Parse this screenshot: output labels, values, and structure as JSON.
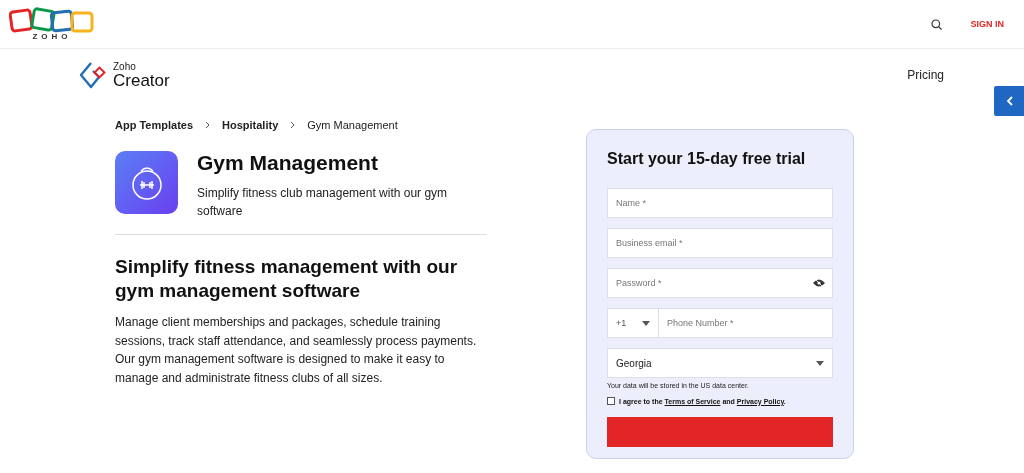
{
  "header": {
    "brand": "ZOHO",
    "sign_in": "SIGN IN"
  },
  "nav": {
    "product_small": "Zoho",
    "product": "Creator",
    "links": [
      "Pricing"
    ]
  },
  "breadcrumb": [
    "App Templates",
    "Hospitality",
    "Gym Management"
  ],
  "app": {
    "title": "Gym Management",
    "subtitle": "Simplify fitness club management with our gym software"
  },
  "section": {
    "heading": "Simplify fitness management with our gym management software",
    "body": "Manage client memberships and packages, schedule training sessions, track staff attendance, and seamlessly process payments. Our gym management software is designed to make it easy to manage and administrate fitness clubs of all sizes."
  },
  "trial_form": {
    "title": "Start your 15-day free trial",
    "fields": [
      {
        "kind": "text",
        "placeholder": "Name *"
      },
      {
        "kind": "text",
        "placeholder": "Business email *"
      },
      {
        "kind": "password",
        "placeholder": "Password *"
      },
      {
        "kind": "phone",
        "code": "+1",
        "placeholder": "Phone Number *"
      },
      {
        "kind": "select",
        "value": "Georgia"
      }
    ],
    "note": "Your data will be stored in the US data center.",
    "agree": {
      "checked": false,
      "text": "I agree to the",
      "terms": "Terms of Service",
      "and": "and",
      "privacy": "Privacy Policy",
      "end": "."
    }
  }
}
